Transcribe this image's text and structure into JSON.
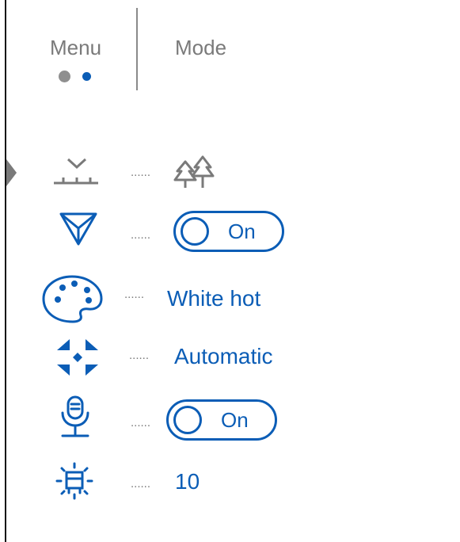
{
  "header": {
    "tabs": [
      {
        "label": "Menu"
      },
      {
        "label": "Mode"
      }
    ],
    "page_indicator": {
      "total": 2,
      "active": 2
    }
  },
  "settings": [
    {
      "icon": "calibration-mode-icon",
      "leader": "......",
      "value_icon": "forest-icon",
      "selected": true
    },
    {
      "icon": "pip-filter-icon",
      "leader": "......",
      "toggle_label": "On",
      "toggle_on": true
    },
    {
      "icon": "color-palette-icon",
      "leader": "......",
      "value": "White hot"
    },
    {
      "icon": "auto-focus-arrows-icon",
      "leader": "......",
      "value": "Automatic"
    },
    {
      "icon": "microphone-icon",
      "leader": "......",
      "toggle_label": "On",
      "toggle_on": true
    },
    {
      "icon": "brightness-display-icon",
      "leader": "......",
      "value": "10"
    }
  ],
  "colors": {
    "accent": "#0b5db6",
    "muted": "#7a7a7a",
    "inactive_dot": "#8f8f8f",
    "border": "#111111"
  }
}
